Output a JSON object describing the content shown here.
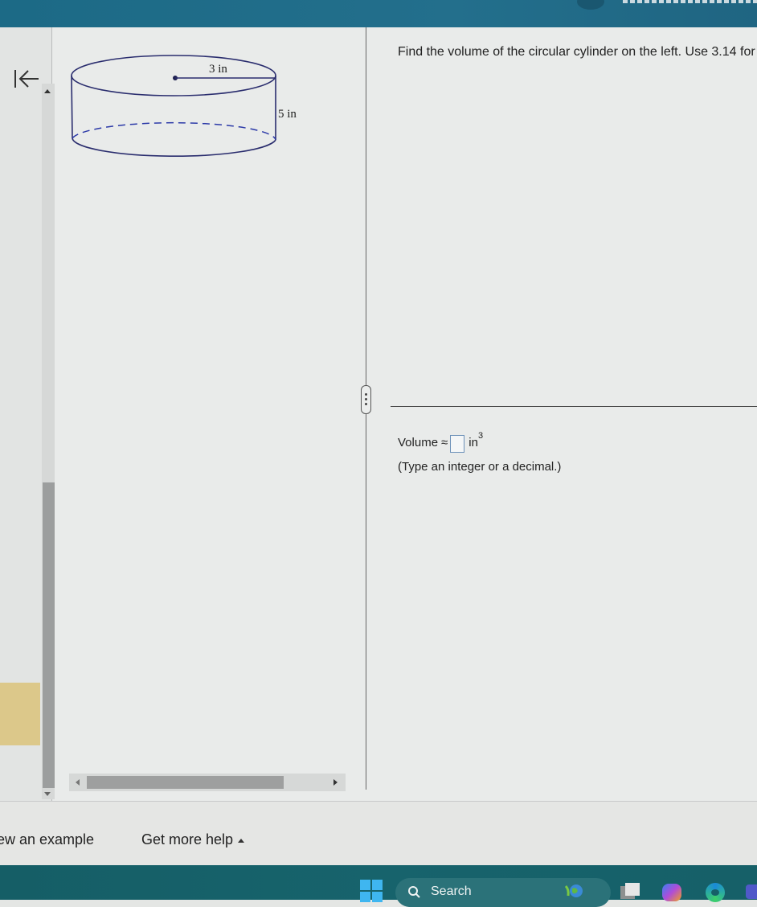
{
  "window": {
    "accent_color": "#1f6a87"
  },
  "navigation": {
    "back_icon": "collapse-left-arrow-icon"
  },
  "figure": {
    "shape": "circular cylinder",
    "radius_label": "3 in",
    "height_label": "5 in",
    "stroke_color": "#2a2d6e"
  },
  "question": {
    "prompt": "Find the volume of the circular cylinder on the left. Use 3.14 for",
    "answer_prefix": "Volume",
    "approx_symbol": "≈",
    "answer_value": "",
    "unit": "in",
    "unit_exponent": "3",
    "hint": "(Type an integer or a decimal.)"
  },
  "footer": {
    "view_example": "ew an example",
    "get_more_help": "Get more help"
  },
  "taskbar": {
    "search_label": "Search",
    "apps": [
      "start-icon",
      "search-highlight-globe-icon",
      "task-view-icon",
      "copilot-icon",
      "edge-icon",
      "teams-icon"
    ]
  }
}
